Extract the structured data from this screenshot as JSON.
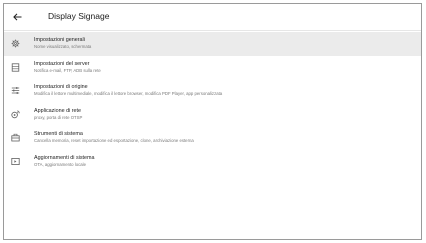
{
  "appbar": {
    "title": "Display Signage",
    "back_icon": "arrow-left-icon"
  },
  "colors": {
    "selected_row": "#ebebeb",
    "title_text": "#202020",
    "subtitle_text": "#7a7a7a",
    "icon": "#5f5f5f"
  },
  "menu": {
    "items": [
      {
        "icon": "gear-icon",
        "label": "Impostazioni generali",
        "subtitle": "Nome visualizzato, schermata",
        "selected": true
      },
      {
        "icon": "server-icon",
        "label": "Impostazioni del server",
        "subtitle": "Notifica e-mail, FTP, ADB sulla rete",
        "selected": false
      },
      {
        "icon": "sliders-icon",
        "label": "Impostazioni di origine",
        "subtitle": "Modifica il lettore multimediale, modifica il lettore browser, modifica PDF Player, app personalizzata",
        "selected": false
      },
      {
        "icon": "network-app-icon",
        "label": "Applicazione di rete",
        "subtitle": "proxy, porta di rete OTSP",
        "selected": false
      },
      {
        "icon": "toolbox-icon",
        "label": "Strumenti di sistema",
        "subtitle": "Cancella memoria, reset importazione ed esportazione, clone, archiviazione esterna",
        "selected": false
      },
      {
        "icon": "system-update-icon",
        "label": "Aggiornamenti di sistema",
        "subtitle": "OTA, aggiornamento locale",
        "selected": false
      }
    ]
  }
}
